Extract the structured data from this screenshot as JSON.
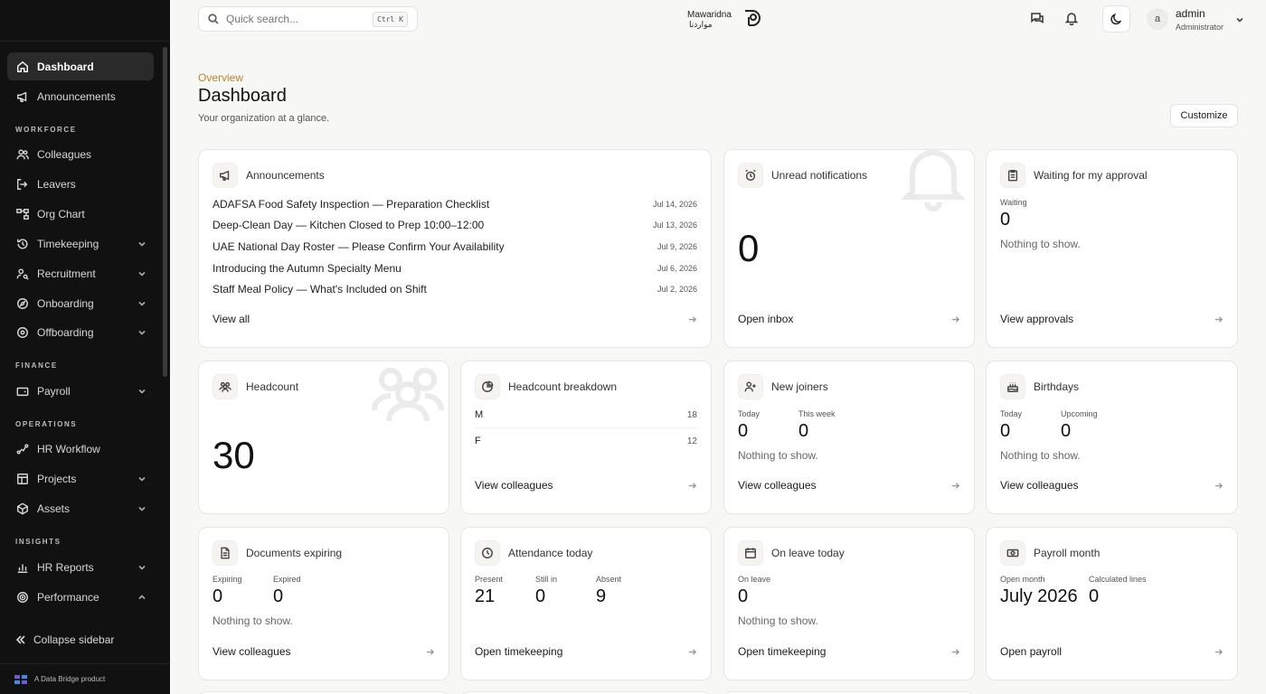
{
  "app": {
    "brand_latin": "Mawaridna",
    "brand_arabic": "مواردنا"
  },
  "sidebar": {
    "items": [
      {
        "label": "Dashboard",
        "icon": "home-icon",
        "active": true
      },
      {
        "label": "Announcements",
        "icon": "megaphone-icon"
      },
      {
        "label": "Colleagues",
        "icon": "users-icon"
      },
      {
        "label": "Leavers",
        "icon": "logout-icon"
      },
      {
        "label": "Org Chart",
        "icon": "org-chart-icon"
      },
      {
        "label": "Timekeeping",
        "icon": "history-icon",
        "expandable": true
      },
      {
        "label": "Recruitment",
        "icon": "user-search-icon",
        "expandable": true
      },
      {
        "label": "Onboarding",
        "icon": "compass-icon",
        "expandable": true
      },
      {
        "label": "Offboarding",
        "icon": "disc-icon",
        "expandable": true
      },
      {
        "label": "Payroll",
        "icon": "wallet-icon",
        "expandable": true
      },
      {
        "label": "HR Workflow",
        "icon": "workflow-icon"
      },
      {
        "label": "Projects",
        "icon": "layout-icon",
        "expandable": true
      },
      {
        "label": "Assets",
        "icon": "package-icon",
        "expandable": true
      },
      {
        "label": "HR Reports",
        "icon": "bar-chart-icon",
        "expandable": true
      },
      {
        "label": "Performance",
        "icon": "target-icon",
        "expandable": true,
        "expanded": true
      }
    ],
    "sections": [
      "WORKFORCE",
      "FINANCE",
      "OPERATIONS",
      "INSIGHTS"
    ],
    "collapse_label": "Collapse sidebar",
    "footer": "A Data Bridge product"
  },
  "topbar": {
    "search_placeholder": "Quick search...",
    "search_shortcut": "Ctrl K",
    "user_initial": "a",
    "user_name": "admin",
    "user_role": "Administrator"
  },
  "header": {
    "eyebrow": "Overview",
    "title": "Dashboard",
    "subtitle": "Your organization at a glance.",
    "customize_label": "Customize"
  },
  "cards": {
    "announcements": {
      "title": "Announcements",
      "items": [
        {
          "title": "ADAFSA Food Safety Inspection — Preparation Checklist",
          "date": "Jul 14, 2026"
        },
        {
          "title": "Deep-Clean Day — Kitchen Closed to Prep 10:00–12:00",
          "date": "Jul 13, 2026"
        },
        {
          "title": "UAE National Day Roster — Please Confirm Your Availability",
          "date": "Jul 9, 2026"
        },
        {
          "title": "Introducing the Autumn Specialty Menu",
          "date": "Jul 6, 2026"
        },
        {
          "title": "Staff Meal Policy — What's Included on Shift",
          "date": "Jul 2, 2026"
        }
      ],
      "link": "View all"
    },
    "unread": {
      "title": "Unread notifications",
      "value": "0",
      "link": "Open inbox"
    },
    "approval": {
      "title": "Waiting for my approval",
      "label": "Waiting",
      "value": "0",
      "empty": "Nothing to show.",
      "link": "View approvals"
    },
    "headcount": {
      "title": "Headcount",
      "value": "30"
    },
    "breakdown": {
      "title": "Headcount breakdown",
      "rows": [
        {
          "label": "M",
          "value": "18"
        },
        {
          "label": "F",
          "value": "12"
        }
      ],
      "link": "View colleagues"
    },
    "joiners": {
      "title": "New joiners",
      "label1": "Today",
      "value1": "0",
      "label2": "This week",
      "value2": "0",
      "empty": "Nothing to show.",
      "link": "View colleagues"
    },
    "birthdays": {
      "title": "Birthdays",
      "label1": "Today",
      "value1": "0",
      "label2": "Upcoming",
      "value2": "0",
      "empty": "Nothing to show.",
      "link": "View colleagues"
    },
    "documents": {
      "title": "Documents expiring",
      "label1": "Expiring",
      "value1": "0",
      "label2": "Expired",
      "value2": "0",
      "empty": "Nothing to show.",
      "link": "View colleagues"
    },
    "attendance": {
      "title": "Attendance today",
      "label1": "Present",
      "value1": "21",
      "label2": "Still in",
      "value2": "0",
      "label3": "Absent",
      "value3": "9",
      "link": "Open timekeeping"
    },
    "leave": {
      "title": "On leave today",
      "label": "On leave",
      "value": "0",
      "empty": "Nothing to show.",
      "link": "Open timekeeping"
    },
    "payroll": {
      "title": "Payroll month",
      "label1": "Open month",
      "value1": "July 2026",
      "label2": "Calculated lines",
      "value2": "0",
      "link": "Open payroll"
    }
  }
}
